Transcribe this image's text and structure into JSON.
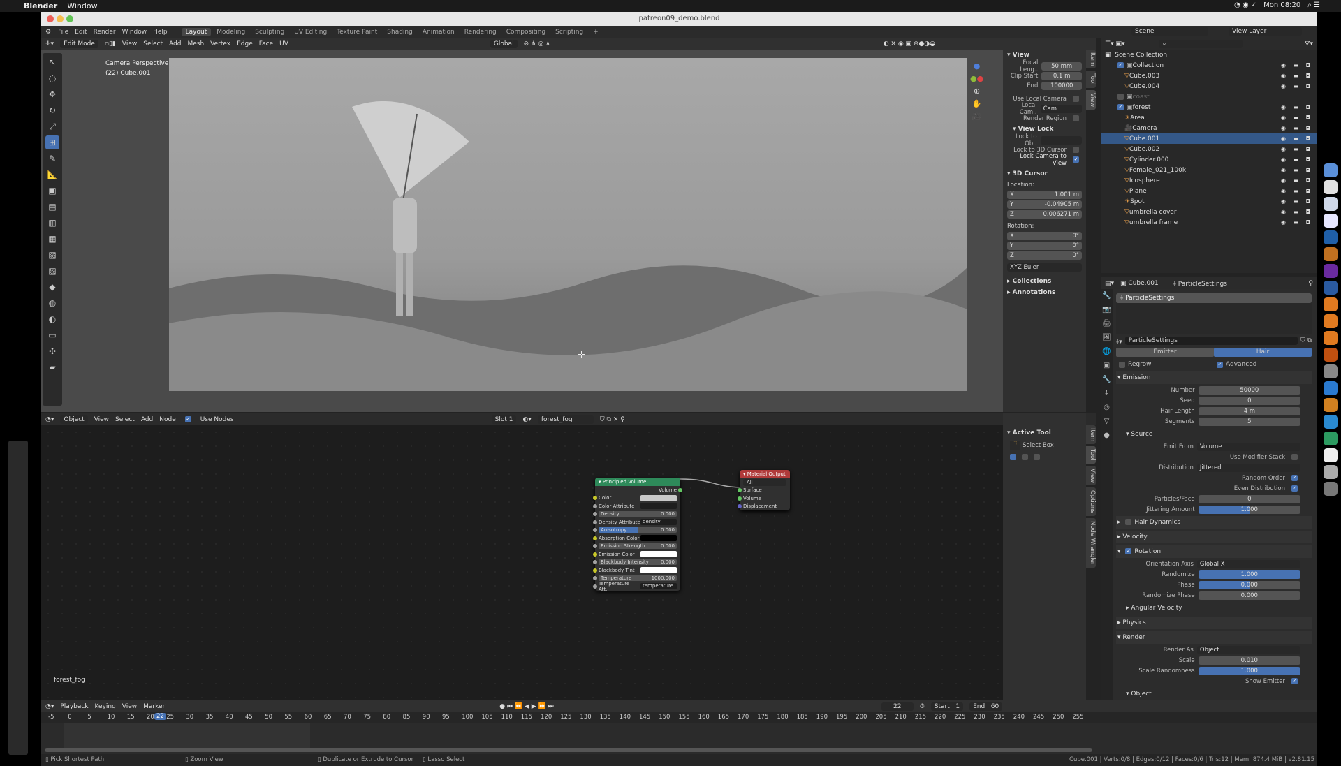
{
  "macos": {
    "app": "Blender",
    "menu": "Window",
    "clock": "Mon 08:20"
  },
  "window": {
    "title": "patreon09_demo.blend"
  },
  "topbar": {
    "menus": [
      "File",
      "Edit",
      "Render",
      "Window",
      "Help"
    ],
    "workspaces": [
      "Layout",
      "Modeling",
      "Sculpting",
      "UV Editing",
      "Texture Paint",
      "Shading",
      "Animation",
      "Rendering",
      "Compositing",
      "Scripting",
      "+"
    ],
    "active_workspace": "Layout",
    "scene": "Scene",
    "view_layer": "View Layer"
  },
  "viewport": {
    "mode": "Edit Mode",
    "menus": [
      "View",
      "Select",
      "Add",
      "Mesh",
      "Vertex",
      "Edge",
      "Face",
      "UV"
    ],
    "orientation": "Global",
    "overlay_title": "Camera Perspective",
    "overlay_object": "(22) Cube.001"
  },
  "npanel": {
    "tabs": [
      "Item",
      "Tool",
      "View"
    ],
    "view_header": "View",
    "focal_label": "Focal Leng..",
    "focal": "50 mm",
    "clip_start_label": "Clip Start",
    "clip_start": "0.1 m",
    "clip_end_label": "End",
    "clip_end": "100000",
    "use_local_camera": "Use Local Camera",
    "local_cam_label": "Local Cam..",
    "local_cam": "Cam",
    "render_region": "Render Region",
    "view_lock": "View Lock",
    "lock_to_obj": "Lock to Ob..",
    "lock_3d_cursor": "Lock to 3D Cursor",
    "lock_camera": "Lock Camera to View",
    "cursor_header": "3D Cursor",
    "location": "Location:",
    "loc": [
      {
        "axis": "X",
        "value": "1.001 m"
      },
      {
        "axis": "Y",
        "value": "-0.04905 m"
      },
      {
        "axis": "Z",
        "value": "0.006271 m"
      }
    ],
    "rotation": "Rotation:",
    "rot": [
      {
        "axis": "X",
        "value": "0°"
      },
      {
        "axis": "Y",
        "value": "0°"
      },
      {
        "axis": "Z",
        "value": "0°"
      }
    ],
    "rot_mode": "XYZ Euler",
    "collections": "Collections",
    "annotations": "Annotations"
  },
  "outliner": {
    "root": "Scene Collection",
    "items": [
      {
        "name": "Collection",
        "depth": 1,
        "type": "collection"
      },
      {
        "name": "Cube.003",
        "depth": 2,
        "type": "mesh"
      },
      {
        "name": "Cube.004",
        "depth": 2,
        "type": "mesh"
      },
      {
        "name": "coast",
        "depth": 1,
        "type": "collection",
        "disabled": true
      },
      {
        "name": "forest",
        "depth": 1,
        "type": "collection"
      },
      {
        "name": "Area",
        "depth": 2,
        "type": "light"
      },
      {
        "name": "Camera",
        "depth": 2,
        "type": "camera"
      },
      {
        "name": "Cube.001",
        "depth": 2,
        "type": "mesh",
        "selected": true
      },
      {
        "name": "Cube.002",
        "depth": 2,
        "type": "mesh"
      },
      {
        "name": "Cylinder.000",
        "depth": 2,
        "type": "mesh"
      },
      {
        "name": "Female_021_100k",
        "depth": 2,
        "type": "mesh"
      },
      {
        "name": "Icosphere",
        "depth": 2,
        "type": "mesh"
      },
      {
        "name": "Plane",
        "depth": 2,
        "type": "mesh"
      },
      {
        "name": "Spot",
        "depth": 2,
        "type": "light"
      },
      {
        "name": "umbrella cover",
        "depth": 2,
        "type": "mesh"
      },
      {
        "name": "umbrella frame",
        "depth": 2,
        "type": "mesh"
      }
    ]
  },
  "properties": {
    "object": "Cube.001",
    "context": "ParticleSettings",
    "list_item": "ParticleSettings",
    "datablock": "ParticleSettings",
    "type_tabs": [
      "Emitter",
      "Hair"
    ],
    "active_type": "Hair",
    "regrow": "Regrow",
    "advanced": "Advanced",
    "sections": [
      {
        "title": "Emission",
        "open": true,
        "rows": [
          {
            "label": "Number",
            "value": "50000"
          },
          {
            "label": "Seed",
            "value": "0"
          },
          {
            "label": "Hair Length",
            "value": "4 m"
          },
          {
            "label": "Segments",
            "value": "5"
          }
        ]
      },
      {
        "title": "Source",
        "open": true,
        "sub": true,
        "rows": [
          {
            "label": "Emit From",
            "value": "Volume",
            "kind": "dd"
          },
          {
            "label": "Use Modifier Stack",
            "kind": "chk",
            "on": false
          },
          {
            "label": "Distribution",
            "value": "Jittered",
            "kind": "dd"
          },
          {
            "label": "Random Order",
            "kind": "chk",
            "on": true
          },
          {
            "label": "Even Distribution",
            "kind": "chk",
            "on": true
          },
          {
            "label": "Particles/Face",
            "value": "0"
          },
          {
            "label": "Jittering Amount",
            "value": "1.000",
            "fill": 50
          }
        ]
      },
      {
        "title": "Hair Dynamics",
        "open": false,
        "check": false
      },
      {
        "title": "Velocity",
        "open": false
      },
      {
        "title": "Rotation",
        "open": true,
        "check": true,
        "rows": [
          {
            "label": "Orientation Axis",
            "value": "Global X",
            "kind": "dd"
          },
          {
            "label": "Randomize",
            "value": "1.000",
            "fill": 100
          },
          {
            "label": "Phase",
            "value": "0.000",
            "fill": 50
          },
          {
            "label": "Randomize Phase",
            "value": "0.000"
          }
        ]
      },
      {
        "title": "Angular Velocity",
        "open": false,
        "sub": true
      },
      {
        "title": "Physics",
        "open": false
      },
      {
        "title": "Render",
        "open": true,
        "rows": [
          {
            "label": "Render As",
            "value": "Object",
            "kind": "dd"
          },
          {
            "label": "Scale",
            "value": "0.010"
          },
          {
            "label": "Scale Randomness",
            "value": "1.000",
            "fill": 100
          },
          {
            "label": "Show Emitter",
            "kind": "chk",
            "on": true
          }
        ]
      },
      {
        "title": "Object",
        "open": true,
        "sub": true
      }
    ]
  },
  "node_editor": {
    "mode": "Object",
    "menus": [
      "View",
      "Select",
      "Add",
      "Node"
    ],
    "use_nodes": "Use Nodes",
    "slot": "Slot 1",
    "material": "forest_fog",
    "footer_label": "forest_fog",
    "side_tabs": [
      "Item",
      "Tool",
      "View",
      "Options",
      "Node Wrangler"
    ],
    "active_tool_header": "Active Tool",
    "active_tool": "Select Box",
    "volume_node": {
      "title": "Principled Volume",
      "output": "Volume",
      "rows": [
        {
          "label": "Color",
          "kind": "color",
          "color": "#c8c8c8",
          "sock": "y"
        },
        {
          "label": "Color Attribute",
          "kind": "text",
          "value": "",
          "sock": "d"
        },
        {
          "label": "Density",
          "value": "0.000",
          "kind": "num",
          "sock": "d"
        },
        {
          "label": "Density Attribute",
          "kind": "text",
          "value": "density",
          "sock": "d"
        },
        {
          "label": "Anisotropy",
          "value": "0.000",
          "kind": "num",
          "sock": "d",
          "hl": true
        },
        {
          "label": "Absorption Color",
          "kind": "color",
          "color": "#000000",
          "sock": "y"
        },
        {
          "label": "Emission Strength",
          "value": "0.000",
          "kind": "num",
          "sock": "d"
        },
        {
          "label": "Emission Color",
          "kind": "color",
          "color": "#ffffff",
          "sock": "y"
        },
        {
          "label": "Blackbody Intensity",
          "value": "0.000",
          "kind": "num",
          "sock": "d"
        },
        {
          "label": "Blackbody Tint",
          "kind": "color",
          "color": "#ffffff",
          "sock": "y"
        },
        {
          "label": "Temperature",
          "value": "1000.000",
          "kind": "num",
          "sock": "d"
        },
        {
          "label": "Temperature Att..",
          "kind": "text",
          "value": "temperature",
          "sock": "d"
        }
      ]
    },
    "output_node": {
      "title": "Material Output",
      "target": "All",
      "inputs": [
        "Surface",
        "Volume",
        "Displacement"
      ]
    }
  },
  "timeline": {
    "menus": [
      "Playback",
      "Keying",
      "View",
      "Marker"
    ],
    "current_frame": "22",
    "start_label": "Start",
    "start": "1",
    "end_label": "End",
    "end": "60",
    "ticks": [
      "-5",
      "0",
      "5",
      "10",
      "15",
      "20",
      "25",
      "30",
      "35",
      "40",
      "45",
      "50",
      "55",
      "60",
      "65",
      "70",
      "75",
      "80",
      "85",
      "90",
      "95",
      "100",
      "105",
      "110",
      "115",
      "120",
      "125",
      "130",
      "135",
      "140",
      "145",
      "150",
      "155",
      "160",
      "165",
      "170",
      "175",
      "180",
      "185",
      "190",
      "195",
      "200",
      "205",
      "210",
      "215",
      "220",
      "225",
      "230",
      "235",
      "240",
      "245",
      "250",
      "255"
    ]
  },
  "statusbar": {
    "hints": [
      "Pick Shortest Path",
      "Zoom View",
      "Duplicate or Extrude to Cursor",
      "Lasso Select"
    ],
    "stats": "Cube.001 | Verts:0/8 | Edges:0/12 | Faces:0/6 | Tris:12 | Mem: 874.4 MiB | v2.81.15"
  },
  "colors": {
    "accent": "#4772b3",
    "selection": "#345888",
    "volume_node": "#2e8a5a",
    "output_node": "#b03a3a"
  }
}
